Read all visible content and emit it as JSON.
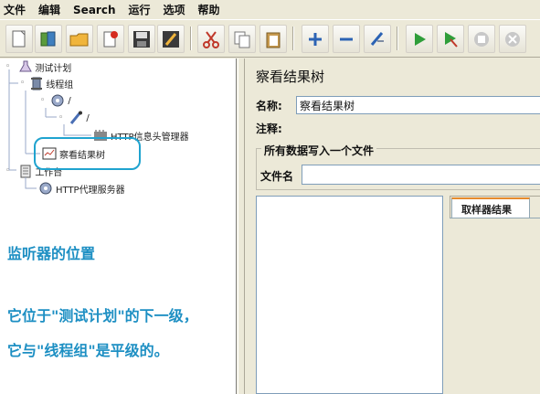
{
  "menu": [
    "文件",
    "编辑",
    "Search",
    "运行",
    "选项",
    "帮助"
  ],
  "toolbar": {
    "buttons": [
      "new-icon",
      "templates-icon",
      "open-icon",
      "close-icon",
      "save-icon",
      "save-as-icon",
      "cut-icon",
      "copy-icon",
      "paste-icon",
      "expand-icon",
      "collapse-icon",
      "toggle-icon",
      "start-icon",
      "start-no-pause-icon",
      "stop-icon",
      "shutdown-icon"
    ]
  },
  "tree": {
    "test_plan": "测试计划",
    "thread_group": "线程组",
    "sampler": "/",
    "sub_sampler": "/",
    "header_manager": "HTTP信息头管理器",
    "view_results_tree": "察看结果树",
    "workbench": "工作台",
    "http_proxy": "HTTP代理服务器"
  },
  "annotation": {
    "title": "监听器的位置",
    "line1": "它位于\"测试计划\"的下一级，",
    "line2": "它与\"线程组\"是平级的。"
  },
  "panel": {
    "title": "察看结果树",
    "name_label": "名称:",
    "name_value": "察看结果树",
    "comment_label": "注释:",
    "comment_value": "",
    "group_title": "所有数据写入一个文件",
    "filename_label": "文件名",
    "filename_value": "",
    "tab_label": "取样器结果"
  },
  "colors": {
    "annotation": "#1d8fc3",
    "highlight": "#1fa3cf",
    "tab_accent": "#e68b2c"
  }
}
